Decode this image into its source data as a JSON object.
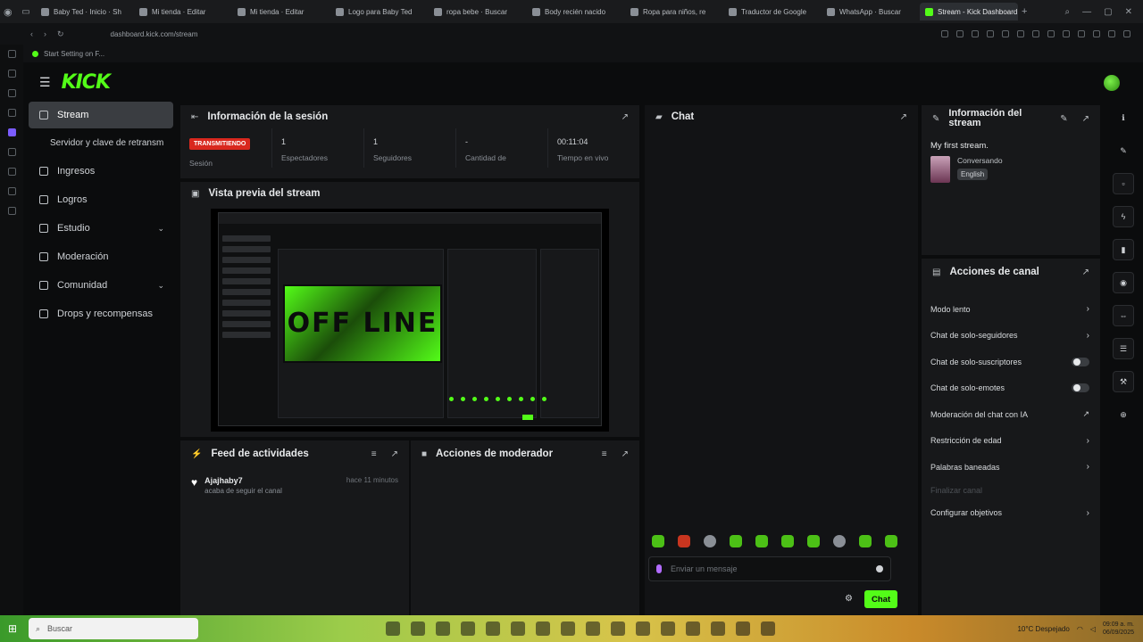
{
  "browser": {
    "tabs": [
      {
        "label": "Baby Ted · Inicio · Sh",
        "active": false
      },
      {
        "label": "Mi tienda · Editar",
        "active": false
      },
      {
        "label": "Mi tienda · Editar",
        "active": false
      },
      {
        "label": "Logo para Baby Ted",
        "active": false
      },
      {
        "label": "ropa bebe · Buscar",
        "active": false
      },
      {
        "label": "Body recién nacido",
        "active": false
      },
      {
        "label": "Ropa para niños, re",
        "active": false
      },
      {
        "label": "Traductor de Google",
        "active": false
      },
      {
        "label": "WhatsApp · Buscar",
        "active": false
      },
      {
        "label": "Stream - Kick Dashboard",
        "active": true
      }
    ],
    "url": "dashboard.kick.com/stream",
    "bookmark": "Start Setting on F..."
  },
  "app": {
    "logo": "KICK",
    "accent": "#53fc18"
  },
  "sidebar": {
    "items": [
      {
        "label": "Stream",
        "icon": "stream-icon",
        "active": true
      },
      {
        "label": "Servidor y clave de retransm",
        "icon": "",
        "sub": true
      },
      {
        "label": "Ingresos",
        "icon": "income-icon"
      },
      {
        "label": "Logros",
        "icon": "trophy-icon"
      },
      {
        "label": "Estudio",
        "icon": "studio-icon",
        "chevron": true
      },
      {
        "label": "Moderación",
        "icon": "moderation-icon"
      },
      {
        "label": "Comunidad",
        "icon": "community-icon",
        "chevron": true
      },
      {
        "label": "Drops y recompensas",
        "icon": "drops-icon"
      }
    ]
  },
  "session": {
    "title": "Información de la sesión",
    "badge": "TRANSMITIENDO",
    "badge_color": "#d9281e",
    "stats": [
      {
        "value": "",
        "label": "Sesión"
      },
      {
        "value": "1",
        "label": "Espectadores"
      },
      {
        "value": "1",
        "label": "Seguidores"
      },
      {
        "value": "-",
        "label": "Cantidad de"
      },
      {
        "value": "00:11:04",
        "label": "Tiempo en vivo"
      }
    ]
  },
  "preview": {
    "title": "Vista previa del stream",
    "offline_text": "OFF LINE"
  },
  "feed": {
    "title": "Feed de actividades",
    "items": [
      {
        "user": "Ajajhaby7",
        "action": "acaba de seguir el canal",
        "time": "hace 11 minutos"
      }
    ]
  },
  "mod_actions": {
    "title": "Acciones de moderador"
  },
  "chat": {
    "title": "Chat",
    "placeholder": "Enviar un mensaje",
    "send_label": "Chat"
  },
  "stream_info": {
    "title": "Información del stream",
    "stream_title": "My first stream.",
    "category": "Conversando",
    "language": "English"
  },
  "channel_actions": {
    "title": "Acciones de canal",
    "items": [
      {
        "label": "Modo lento",
        "control": "chevron"
      },
      {
        "label": "Chat de solo-seguidores",
        "control": "chevron"
      },
      {
        "label": "Chat de solo-suscriptores",
        "control": "toggle"
      },
      {
        "label": "Chat de solo-emotes",
        "control": "toggle"
      },
      {
        "label": "Moderación del chat con IA",
        "control": "external"
      },
      {
        "label": "Restricción de edad",
        "control": "chevron"
      },
      {
        "label": "Palabras baneadas",
        "control": "chevron"
      },
      {
        "label": "Finalizar canal",
        "control": "none",
        "muted": true
      },
      {
        "label": "Configurar objetivos",
        "control": "chevron"
      }
    ]
  },
  "taskbar": {
    "search_placeholder": "Buscar",
    "weather": "10°C Despejado",
    "time": "09:09 a. m.",
    "date": "06/09/2025"
  }
}
